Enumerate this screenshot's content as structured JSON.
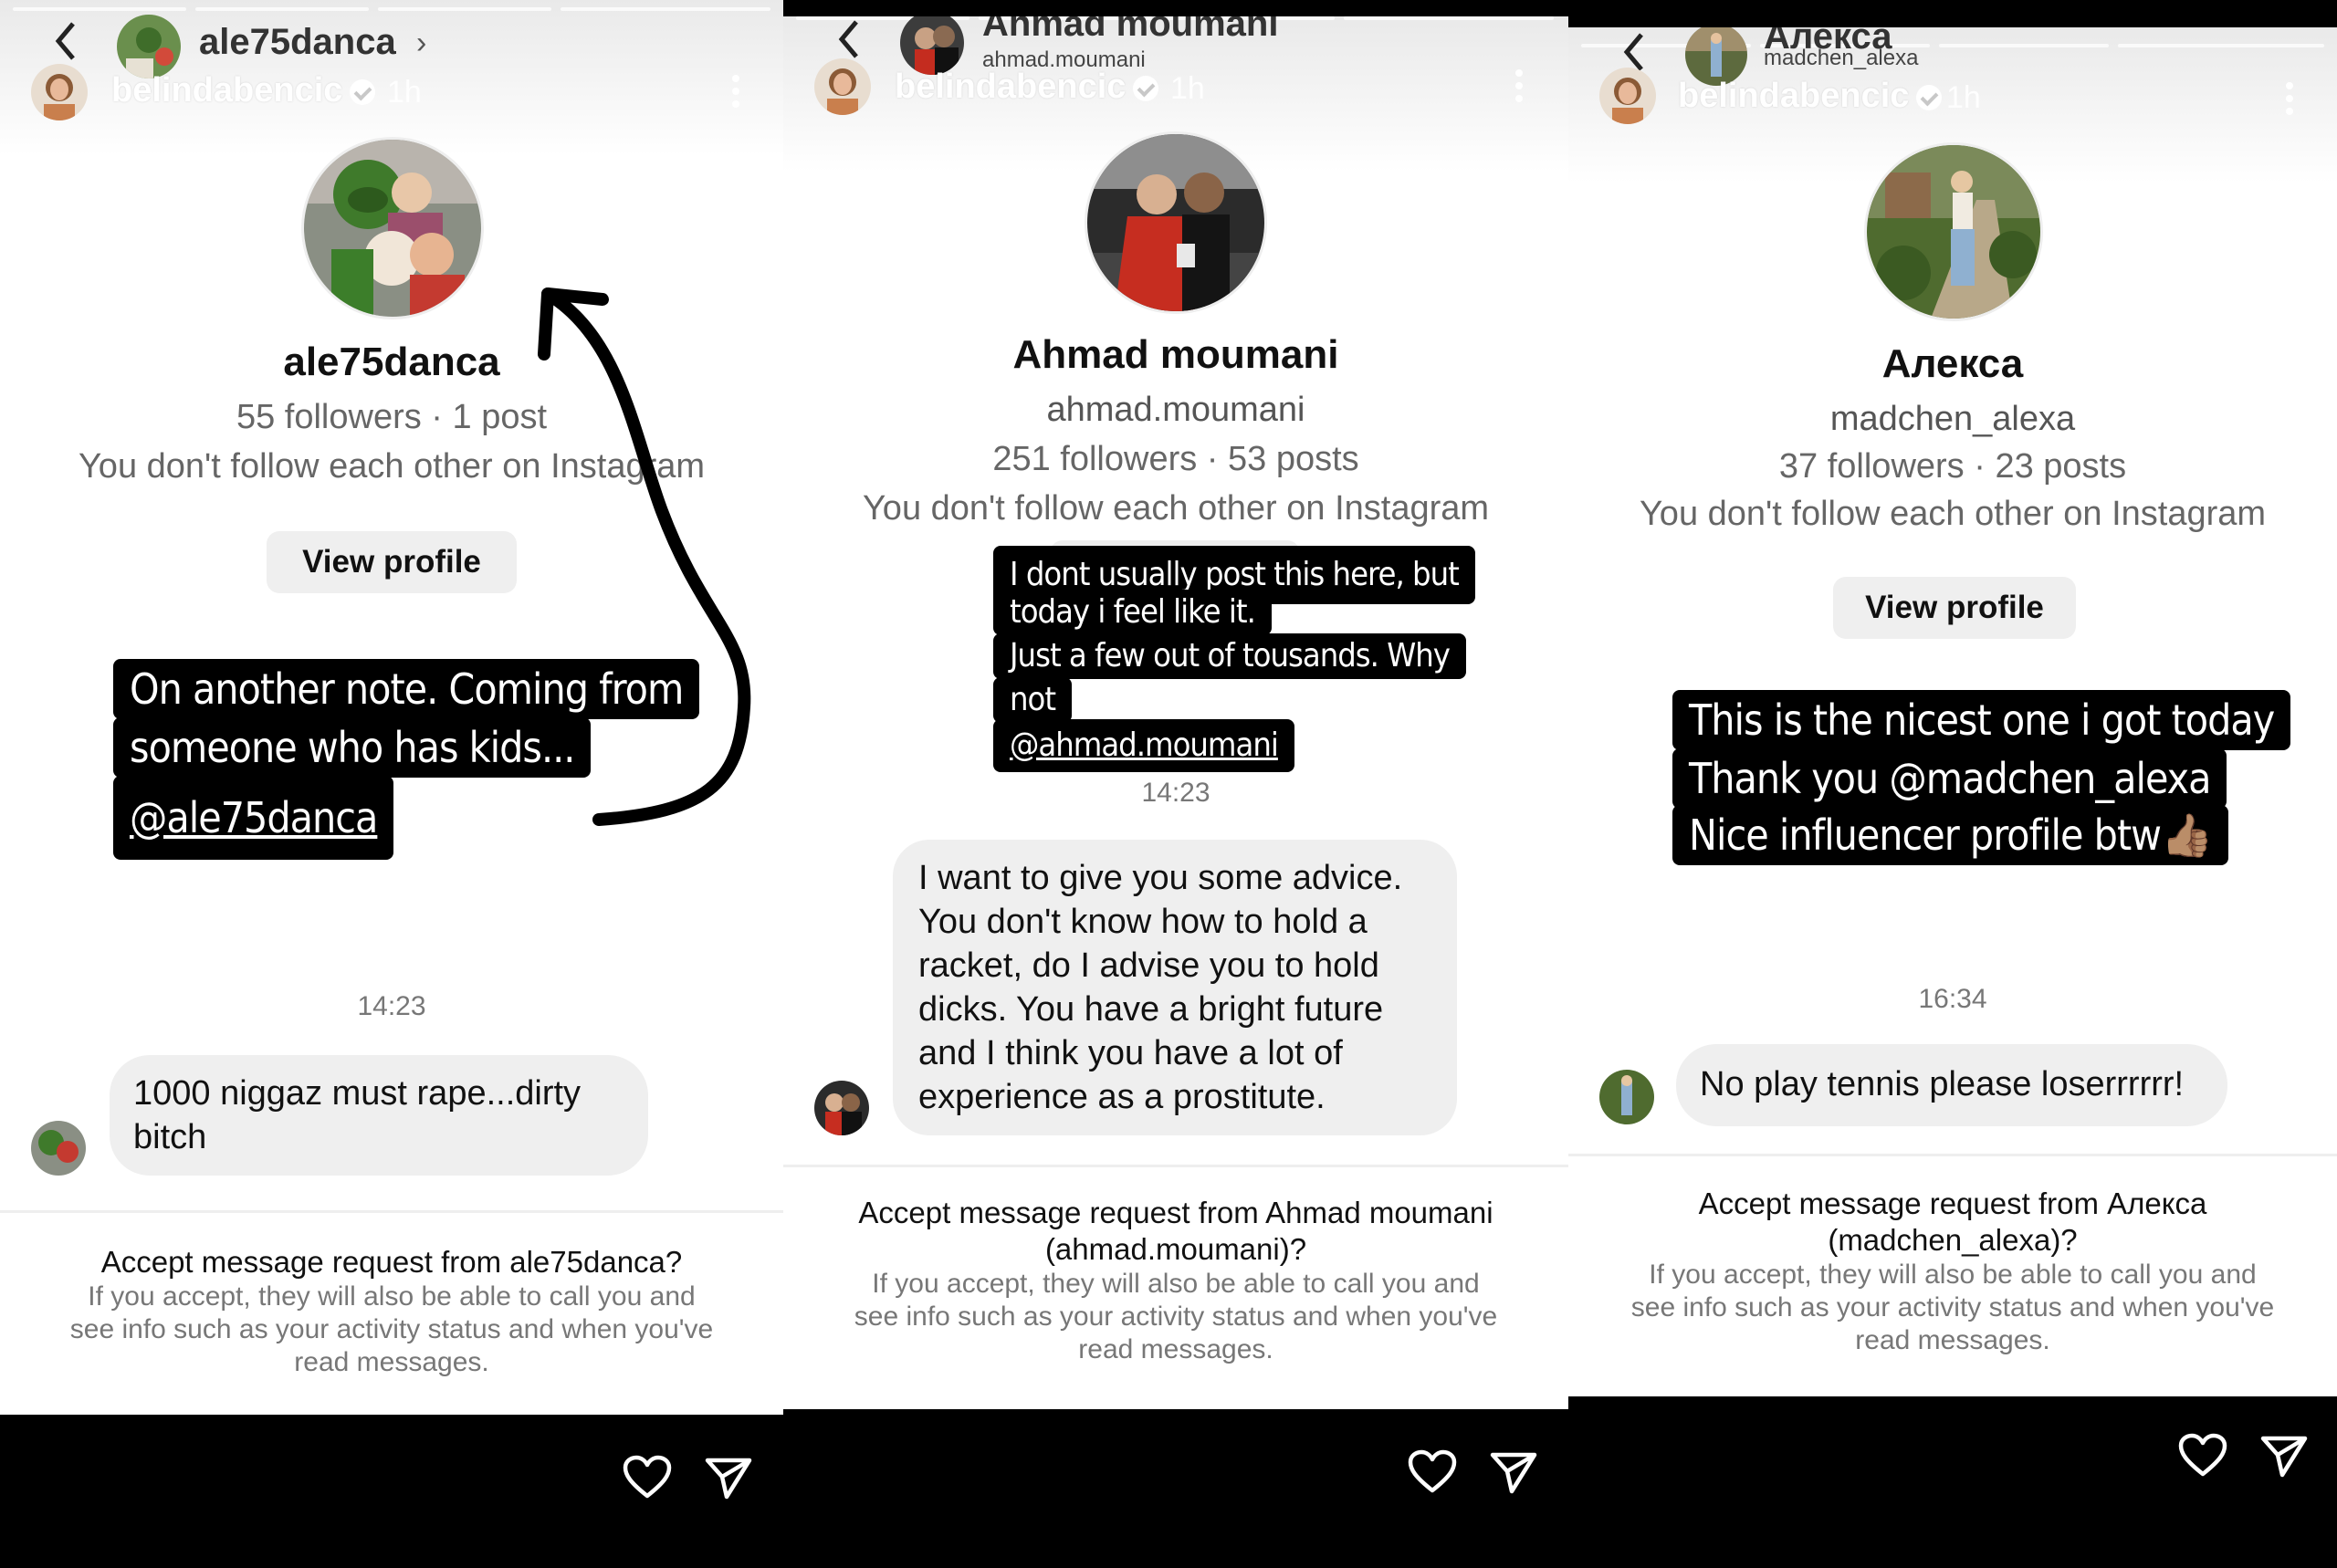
{
  "panels": [
    {
      "header": {
        "poster": "belindabencic",
        "time": "1h",
        "chat_name": "ale75danca",
        "chat_sub": ""
      },
      "profile": {
        "name": "ale75danca",
        "username": "",
        "stats": "55 followers · 1 post",
        "follow_note": "You don't follow each other on Instagram",
        "view_profile": "View profile"
      },
      "sticker": {
        "lines": [
          "On another note. Coming from",
          "someone who has kids...",
          "@ale75danca"
        ]
      },
      "timestamp": "14:23",
      "message": [
        "1000 niggaz must rape...dirty",
        "bitch"
      ],
      "request": {
        "title": [
          "Accept message request from ale75danca?"
        ],
        "body": [
          "If you accept, they will also be able to call you and",
          "see info such as your activity status and when you've",
          "read messages."
        ]
      }
    },
    {
      "header": {
        "poster": "belindabencic",
        "time": "1h",
        "chat_name": "Ahmad moumani",
        "chat_sub": "ahmad.moumani"
      },
      "profile": {
        "name": "Ahmad  moumani",
        "username": "ahmad.moumani",
        "stats": "251 followers · 53 posts",
        "follow_note": "You don't follow each other on Instagram",
        "view_profile": ""
      },
      "sticker": {
        "lines": [
          "I dont usually post this here, but",
          "today i feel like it.",
          "Just a few out of tousands. Why",
          "not",
          "@ahmad.moumani"
        ]
      },
      "timestamp": "14:23",
      "message": [
        "I want to give you some advice.",
        "You don't know how to hold a",
        "racket, do I advise you to hold",
        "dicks. You have a bright future",
        "and I think you have a lot of",
        "experience as a prostitute."
      ],
      "request": {
        "title": [
          "Accept message request from Ahmad  moumani",
          "(ahmad.moumani)?"
        ],
        "body": [
          "If you accept, they will also be able to call you and",
          "see info such as your activity status and when you've",
          "read messages."
        ]
      }
    },
    {
      "header": {
        "poster": "belindabencic",
        "time": "1h",
        "chat_name": "Алекса",
        "chat_sub": "madchen_alexa"
      },
      "profile": {
        "name": "Алекса",
        "username": "madchen_alexa",
        "stats": "37 followers · 23 posts",
        "follow_note": "You don't follow each other on Instagram",
        "view_profile": "View profile"
      },
      "sticker": {
        "lines": [
          "This is the nicest one i got today",
          "Thank you @madchen_alexa",
          "Nice influencer profile btw👍🏽"
        ]
      },
      "timestamp": "16:34",
      "message": [
        "No play tennis please loserrrrrr!"
      ],
      "request": {
        "title": [
          "Accept message request from Алекса",
          "(madchen_alexa)?"
        ],
        "body": [
          "If you accept, they will also be able to call you and",
          "see info such as your activity status and when you've",
          "read messages."
        ]
      }
    }
  ],
  "icons": {
    "like": "heart-icon",
    "share": "send-icon",
    "more": "more-icon",
    "back": "chevron-left-icon"
  },
  "colors": {
    "sticker_bg": "#000000",
    "bubble_bg": "#efefef",
    "bottom_bar": "#000000"
  }
}
